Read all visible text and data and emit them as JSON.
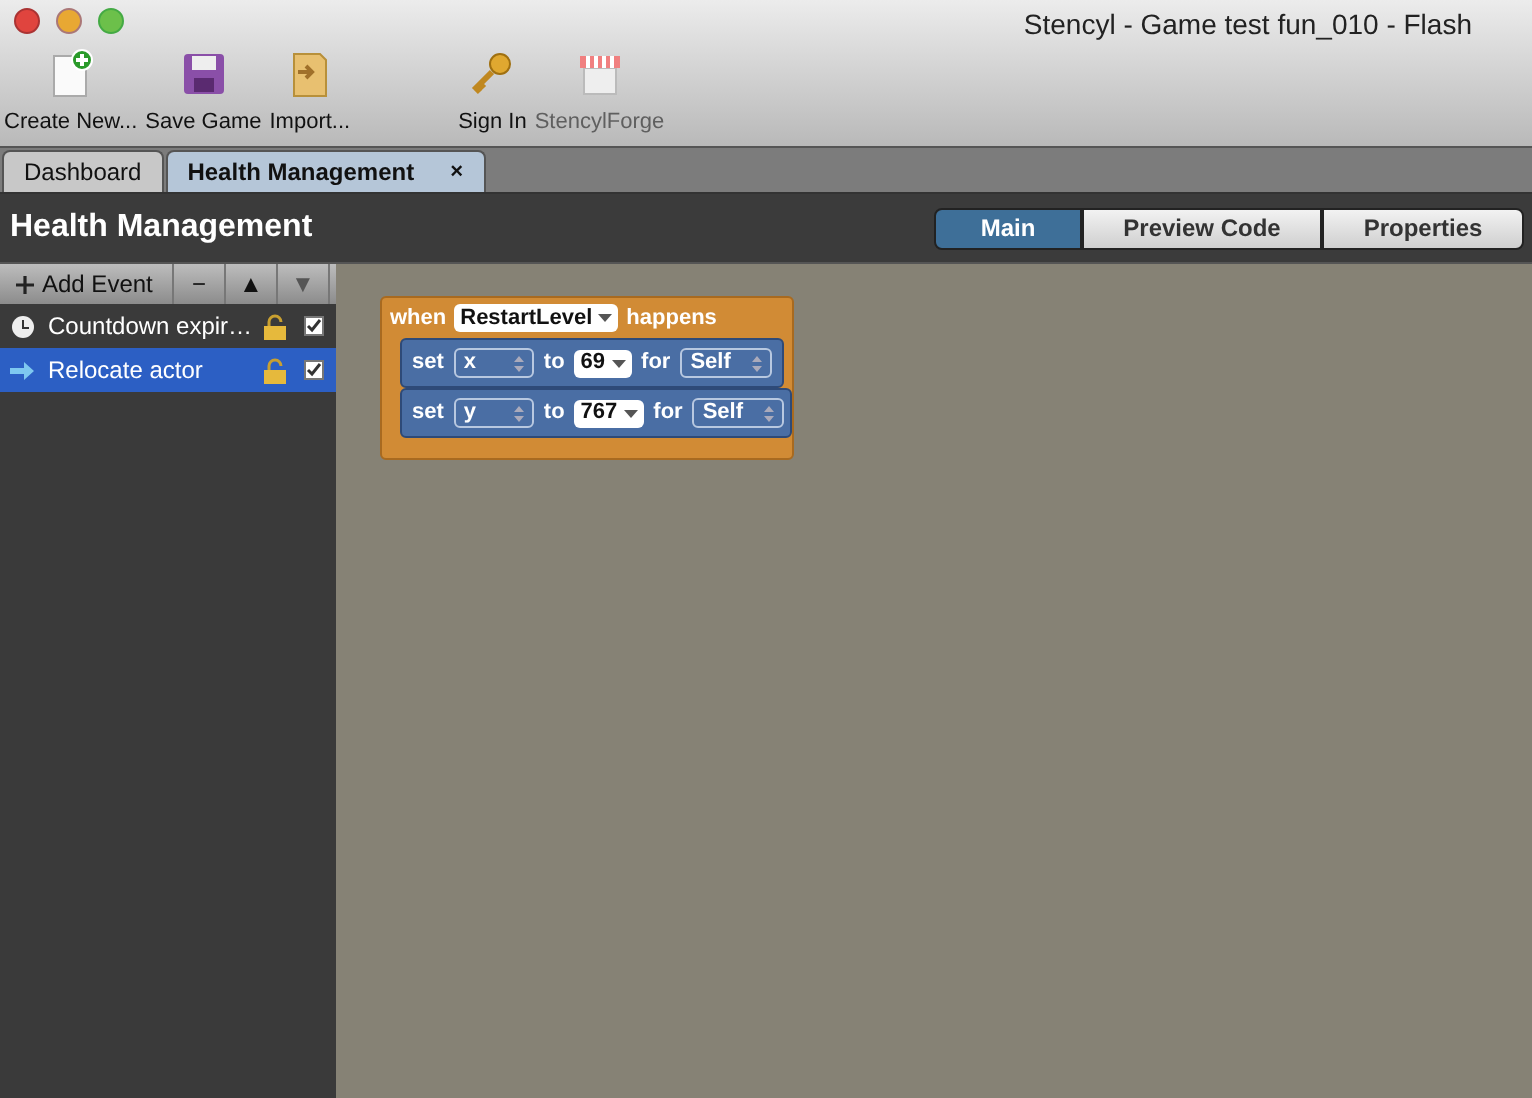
{
  "window": {
    "title": "Stencyl - Game test fun_010 - Flash"
  },
  "toolbar": [
    {
      "label": "Create New...",
      "kind": "new",
      "disabled": false
    },
    {
      "label": "Save Game",
      "kind": "save",
      "disabled": false
    },
    {
      "label": "Import...",
      "kind": "import",
      "disabled": false
    },
    {
      "label": "Sign In",
      "kind": "key",
      "disabled": false
    },
    {
      "label": "StencylForge",
      "kind": "store",
      "disabled": true
    }
  ],
  "tabs": [
    {
      "label": "Dashboard",
      "selected": false
    },
    {
      "label": "Health Management",
      "selected": true,
      "close": "×"
    }
  ],
  "header": {
    "title": "Health Management"
  },
  "view_tabs": [
    {
      "label": "Main",
      "selected": true
    },
    {
      "label": "Preview Code",
      "selected": false
    },
    {
      "label": "Properties",
      "selected": false
    }
  ],
  "event_toolbar": {
    "add_label": "Add Event",
    "buttons": [
      {
        "label": "−",
        "disabled": false
      },
      {
        "label": "▲",
        "disabled": false
      },
      {
        "label": "▼",
        "disabled": true
      }
    ]
  },
  "events": [
    {
      "label": "Countdown expir…",
      "kind": "clock",
      "selected": false,
      "checked": true
    },
    {
      "label": "Relocate actor",
      "kind": "arrow",
      "selected": true,
      "checked": true
    }
  ],
  "block": {
    "keyword": "when",
    "event": "RestartLevel",
    "suffix": "happens",
    "statements": [
      {
        "verb": "set",
        "attribute": "x",
        "to": "to",
        "value": "69",
        "for": "for",
        "target": "Self"
      },
      {
        "verb": "set",
        "attribute": "y",
        "to": "to",
        "value": "767",
        "for": "for",
        "target": "Self"
      }
    ]
  }
}
